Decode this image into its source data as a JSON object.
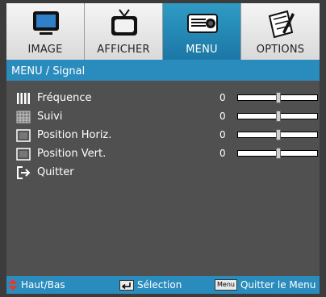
{
  "tabs": [
    {
      "label": "IMAGE",
      "icon": "monitor-icon",
      "active": false
    },
    {
      "label": "AFFICHER",
      "icon": "tv-icon",
      "active": false
    },
    {
      "label": "MENU",
      "icon": "projector-icon",
      "active": true
    },
    {
      "label": "OPTIONS",
      "icon": "notepad-icon",
      "active": false
    }
  ],
  "title": "MENU / Signal",
  "rows": [
    {
      "label": "Fréquence",
      "value": "0",
      "icon": "bars-icon",
      "slider": 0.5
    },
    {
      "label": "Suivi",
      "value": "0",
      "icon": "grid-icon",
      "slider": 0.5
    },
    {
      "label": "Position Horiz.",
      "value": "0",
      "icon": "square-icon",
      "slider": 0.5
    },
    {
      "label": "Position Vert.",
      "value": "0",
      "icon": "square-icon",
      "slider": 0.5
    },
    {
      "label": "Quitter",
      "icon": "exit-icon"
    }
  ],
  "footer": {
    "nav_label": "Haut/Bas",
    "select_label": "Sélection",
    "menu_key": "Menu",
    "exit_label": "Quitter le Menu"
  },
  "colors": {
    "accent": "#2a8cbd",
    "background": "#505050"
  }
}
